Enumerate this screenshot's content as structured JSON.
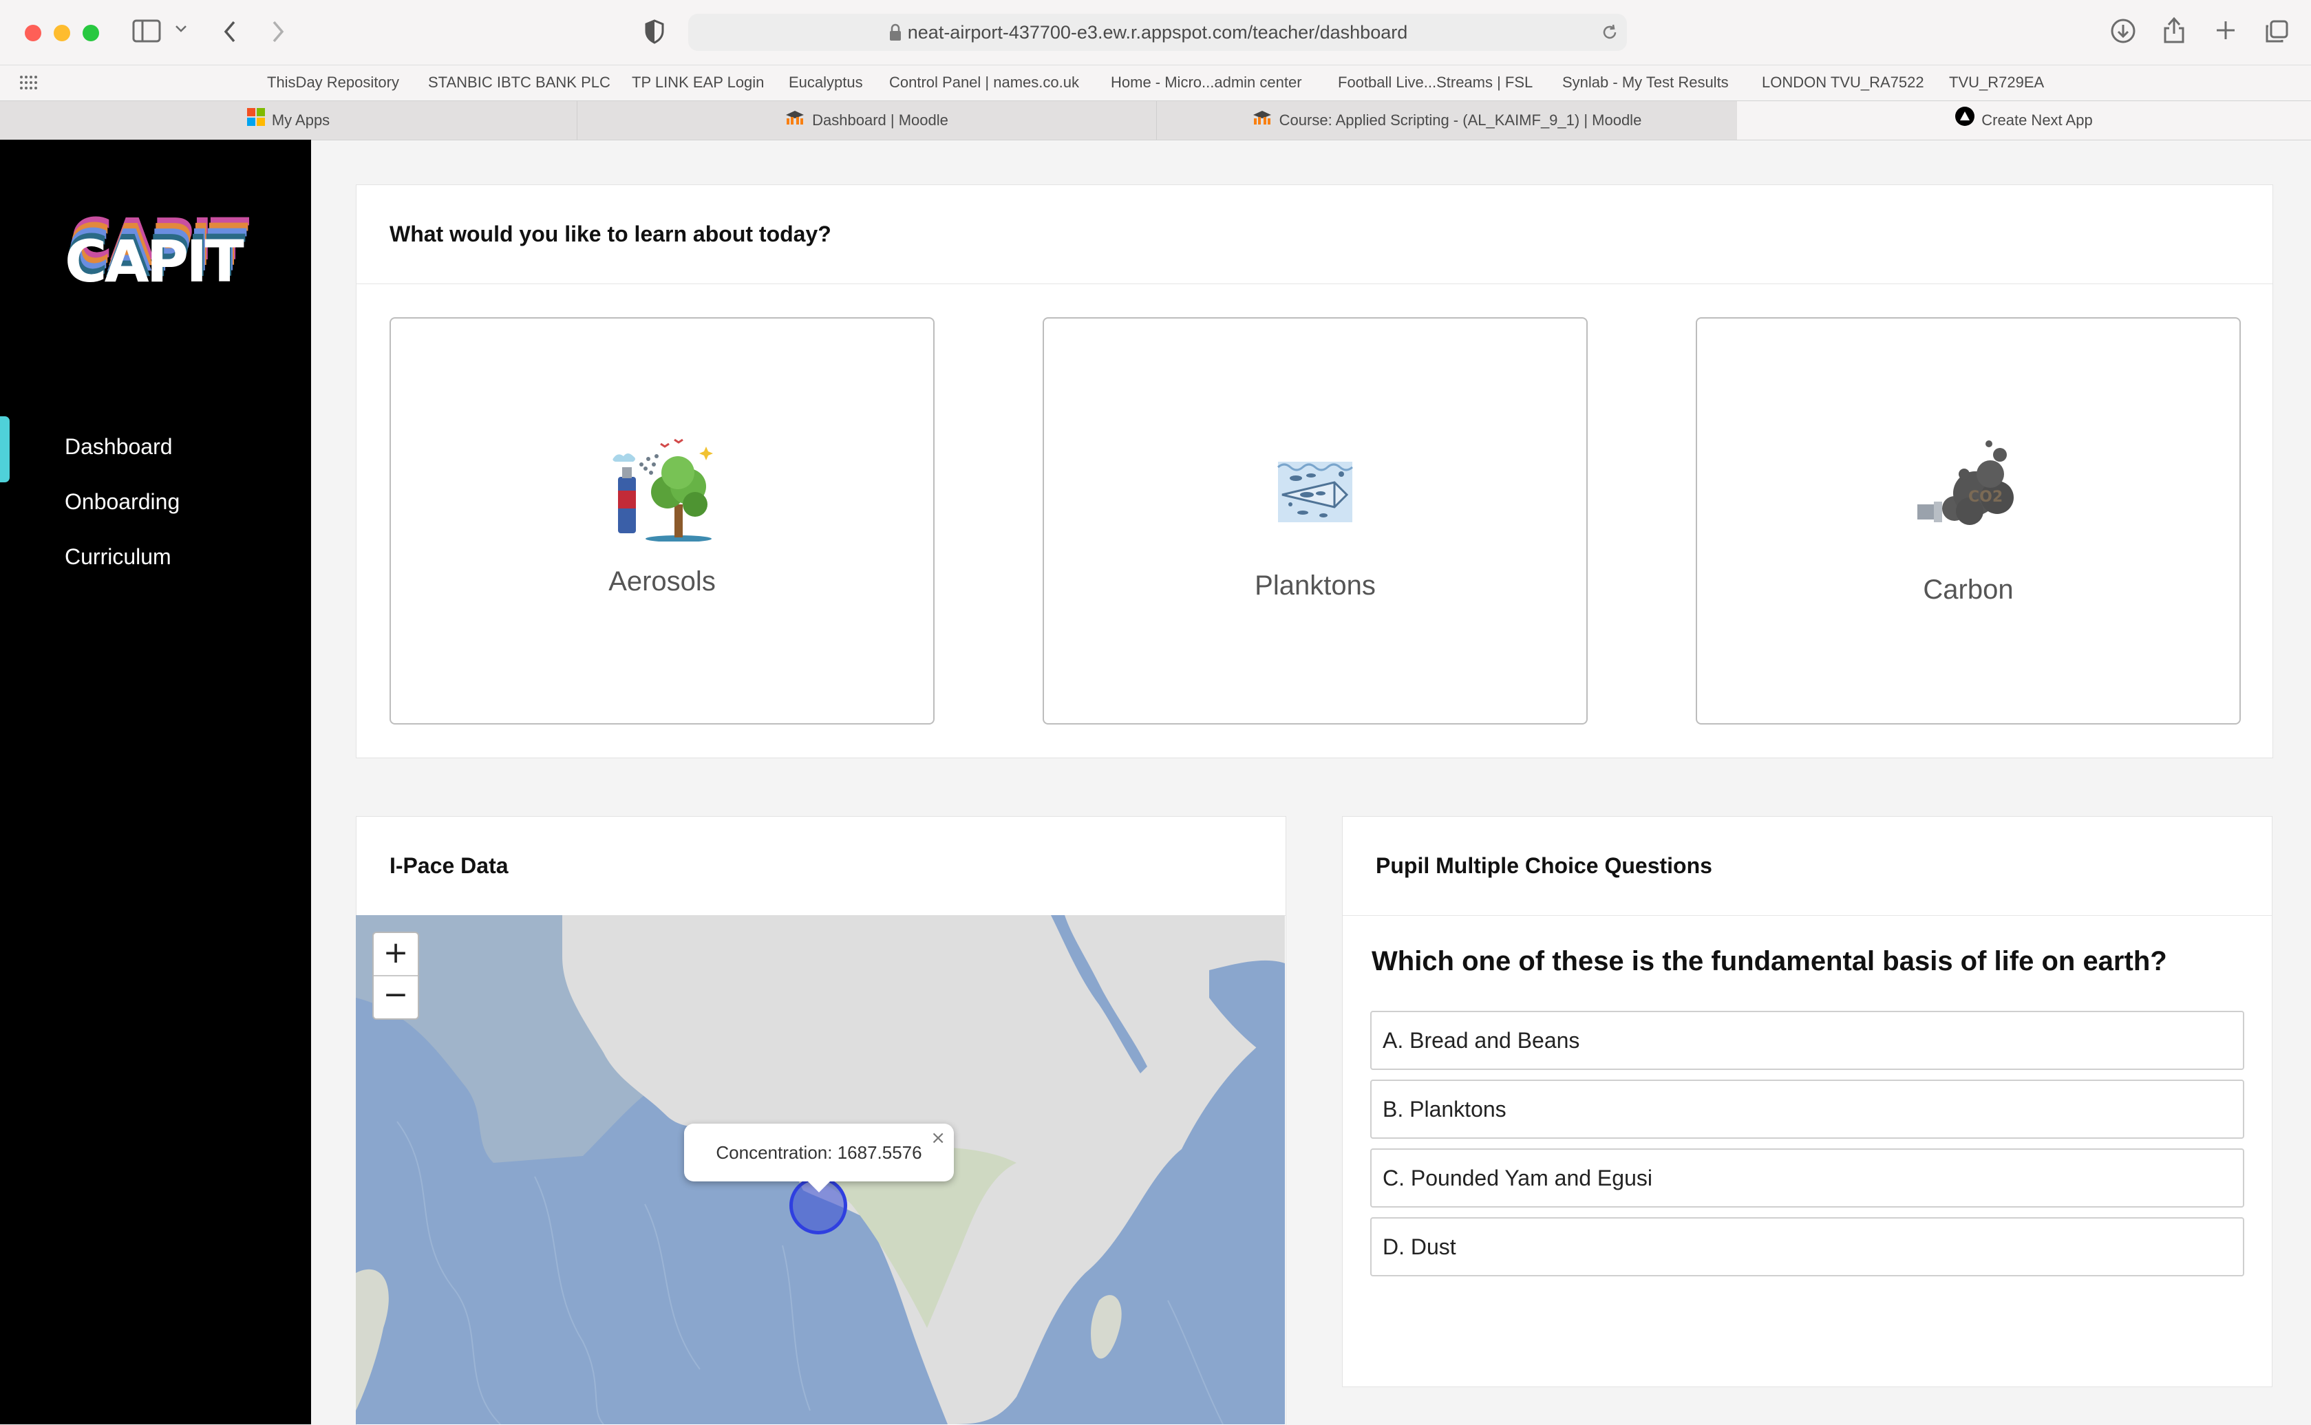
{
  "browser": {
    "url": "neat-airport-437700-e3.ew.r.appspot.com/teacher/dashboard",
    "bookmarks": [
      "ThisDay Repository",
      "STANBIC IBTC BANK PLC",
      "TP LINK EAP Login",
      "Eucalyptus",
      "Control Panel | names.co.uk",
      "Home - Micro...admin center",
      "Football Live...Streams | FSL",
      "Synlab - My Test Results",
      "LONDON TVU_RA7522",
      "TVU_R729EA"
    ],
    "tabs": [
      "My Apps",
      "Dashboard | Moodle",
      "Course: Applied Scripting - (AL_KAIMF_9_1) | Moodle",
      "Create Next App"
    ],
    "active_tab_index": 3
  },
  "sidebar": {
    "logo_text": "CAPIT",
    "items": [
      "Dashboard",
      "Onboarding",
      "Curriculum"
    ],
    "active_item": "Dashboard"
  },
  "topics": {
    "title": "What would you like to learn about today?",
    "items": [
      {
        "label": "Aerosols",
        "icon": "aerosol-tree-icon"
      },
      {
        "label": "Planktons",
        "icon": "plankton-icon"
      },
      {
        "label": "Carbon",
        "icon": "co2-smoke-icon"
      }
    ]
  },
  "ipace": {
    "title": "I-Pace Data",
    "zoom_in": "+",
    "zoom_out": "−",
    "popup_text": "Concentration: 1687.5576",
    "popup_close": "×"
  },
  "mcq": {
    "title": "Pupil Multiple Choice Questions",
    "question": "Which one of these is the fundamental basis of life on earth?",
    "options": [
      "A. Bread and Beans",
      "B. Planktons",
      "C. Pounded Yam and Egusi",
      "D. Dust"
    ]
  },
  "colors": {
    "sidebar_bg": "#000000",
    "nav_indicator": "#4fd1d9",
    "map_marker": "#3a4fd6"
  }
}
